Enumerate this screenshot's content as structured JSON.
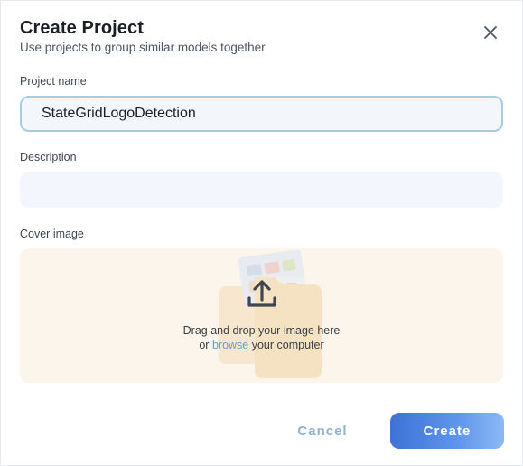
{
  "dialog": {
    "title": "Create Project",
    "subtitle": "Use projects to group similar models together",
    "close_icon": "close-icon"
  },
  "fields": {
    "project_name": {
      "label": "Project name",
      "value": "StateGridLogoDetection",
      "placeholder": ""
    },
    "description": {
      "label": "Description",
      "value": "",
      "placeholder": ""
    },
    "cover_image": {
      "label": "Cover image",
      "drop_text": "Drag and drop your image here",
      "or_text": "or",
      "browse_text": "browse",
      "computer_text": "your computer",
      "icon": "upload-icon"
    }
  },
  "actions": {
    "cancel_label": "Cancel",
    "create_label": "Create"
  },
  "colors": {
    "accent": "#4a82e0",
    "link": "#5e9fd8",
    "dropzone_bg": "#fcf5eb",
    "input_bg": "#f3f6fc",
    "input_border_focus": "#a9cbe0"
  }
}
